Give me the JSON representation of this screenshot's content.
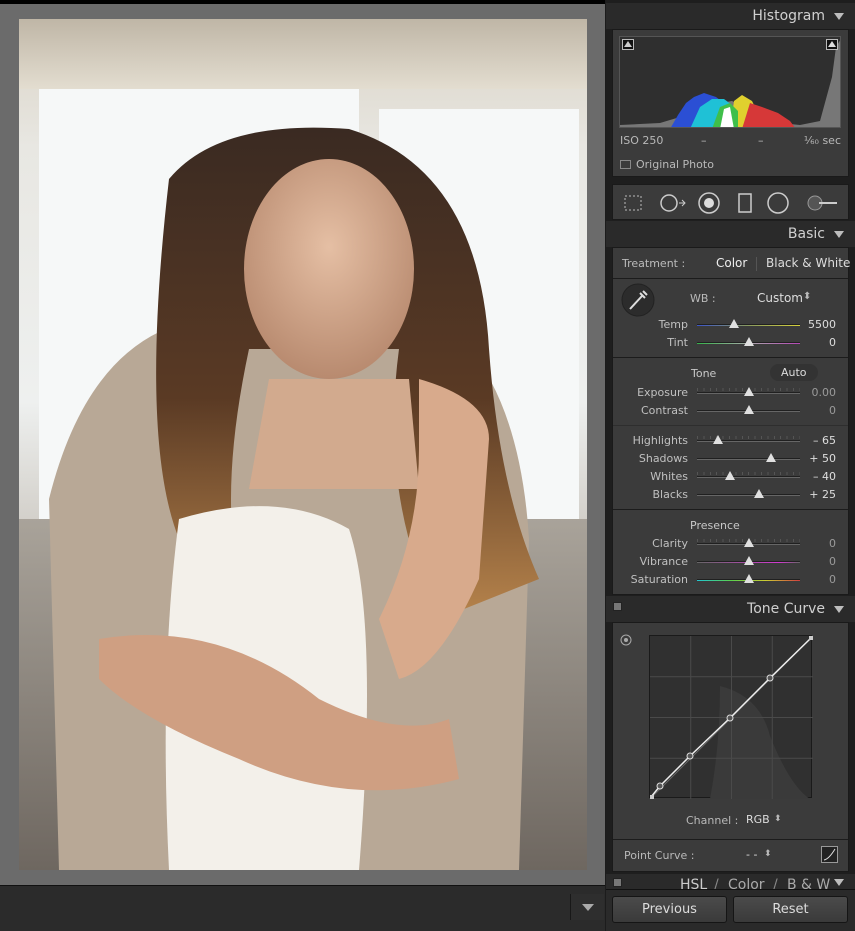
{
  "histogram": {
    "title": "Histogram",
    "iso": "ISO 250",
    "dash1": "–",
    "dash2": "–",
    "shutter": "¹⁄₆₀ sec",
    "original_photo_label": "Original Photo"
  },
  "tools": [
    "crop-overlay",
    "spot-removal",
    "red-eye",
    "graduated-filter",
    "radial-filter",
    "adjustment-brush"
  ],
  "basic": {
    "title": "Basic",
    "treatment_label": "Treatment :",
    "color_label": "Color",
    "bw_label": "Black & White",
    "wb_label": "WB :",
    "wb_value": "Custom",
    "wb_arrows": "⬍",
    "temp": {
      "label": "Temp",
      "value": "5500",
      "pos": 0.36
    },
    "tint": {
      "label": "Tint",
      "value": "0",
      "pos": 0.5
    },
    "tone_label": "Tone",
    "auto_label": "Auto",
    "exposure": {
      "label": "Exposure",
      "value": "0.00",
      "pos": 0.5
    },
    "contrast": {
      "label": "Contrast",
      "value": "0",
      "pos": 0.5
    },
    "highlights": {
      "label": "Highlights",
      "value": "– 65",
      "pos": 0.2
    },
    "shadows": {
      "label": "Shadows",
      "value": "+ 50",
      "pos": 0.72
    },
    "whites": {
      "label": "Whites",
      "value": "– 40",
      "pos": 0.32
    },
    "blacks": {
      "label": "Blacks",
      "value": "+ 25",
      "pos": 0.6
    },
    "presence_label": "Presence",
    "clarity": {
      "label": "Clarity",
      "value": "0",
      "pos": 0.5
    },
    "vibrance": {
      "label": "Vibrance",
      "value": "0",
      "pos": 0.5
    },
    "saturation": {
      "label": "Saturation",
      "value": "0",
      "pos": 0.5
    }
  },
  "tone_curve": {
    "title": "Tone Curve",
    "channel_label": "Channel :",
    "channel_value": "RGB",
    "point_curve_label": "Point Curve :",
    "point_curve_value": "- -"
  },
  "hsl": {
    "hsl": "HSL",
    "sep": "/",
    "color": "Color",
    "bw": "B & W"
  },
  "buttons": {
    "previous": "Previous",
    "reset": "Reset"
  }
}
